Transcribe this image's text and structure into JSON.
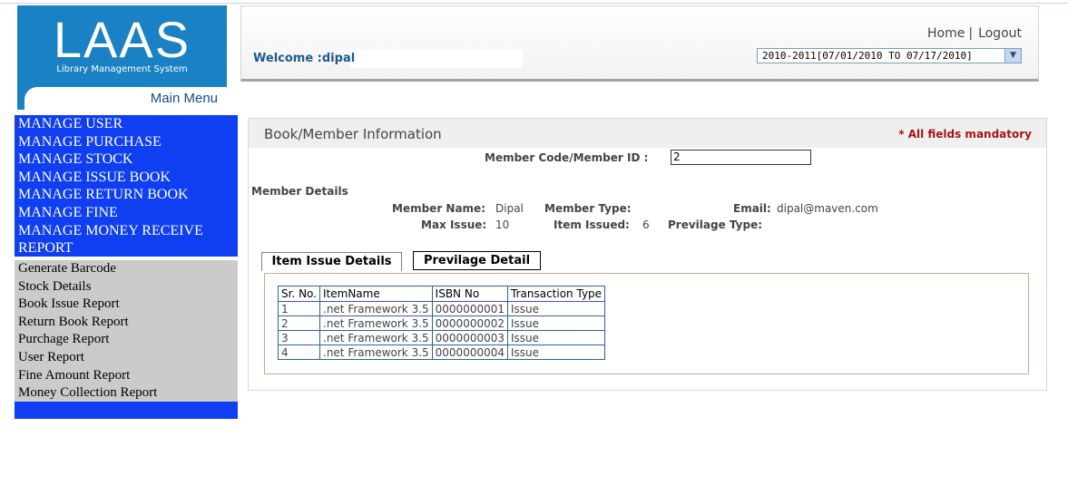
{
  "logo": {
    "text": "LAAS",
    "subtitle": "Library Management System",
    "main_menu": "Main Menu"
  },
  "header": {
    "welcome": "Welcome :dipal",
    "home": "Home",
    "separator": "|",
    "logout": "Logout",
    "session": "2010-2011[07/01/2010 TO 07/17/2010]"
  },
  "menu": {
    "manage_items": [
      "MANAGE USER",
      "MANAGE PURCHASE",
      "MANAGE STOCK",
      "MANAGE ISSUE BOOK",
      "MANAGE RETURN BOOK",
      "MANAGE FINE",
      "MANAGE MONEY RECEIVE",
      "REPORT"
    ],
    "report_items": [
      "Generate Barcode",
      "Stock Details",
      "Book Issue Report",
      "Return Book Report",
      "Purchage Report",
      "User Report",
      "Fine Amount Report",
      "Money Collection Report"
    ]
  },
  "panel": {
    "title": "Book/Member Information",
    "mandatory": "* All fields mandatory",
    "member_code_label": "Member Code/Member ID :",
    "member_code_value": "2",
    "member_details": "Member Details",
    "member_name_label": "Member Name:",
    "member_name_value": "Dipal",
    "member_type_label": "Member Type:",
    "member_type_value": "",
    "email_label": "Email:",
    "email_value": "dipal@maven.com",
    "max_issue_label": "Max Issue:",
    "max_issue_value": "10",
    "item_issued_label": "Item Issued:",
    "item_issued_value": "6",
    "previlage_type_label": "Previlage Type:",
    "previlage_type_value": ""
  },
  "tabs": {
    "item_issue": "Item Issue Details",
    "previlage": "Previlage Detail"
  },
  "table": {
    "headers": [
      "Sr. No.",
      "ItemName",
      "ISBN No",
      "Transaction Type"
    ],
    "rows": [
      [
        "1",
        ".net Framework 3.5",
        "0000000001",
        "Issue"
      ],
      [
        "2",
        ".net Framework 3.5",
        "0000000002",
        "Issue"
      ],
      [
        "3",
        ".net Framework 3.5",
        "0000000003",
        "Issue"
      ],
      [
        "4",
        ".net Framework 3.5",
        "0000000004",
        "Issue"
      ]
    ]
  },
  "colors": {
    "menu_blue": "#0f3ff0",
    "menu_gray": "#cbcbcb",
    "logo_blue": "#1a82c4",
    "mandatory_red": "#a31515",
    "table_border": "#2f5fa6"
  },
  "icons": {
    "session_dropdown": "chevron-down-icon"
  }
}
